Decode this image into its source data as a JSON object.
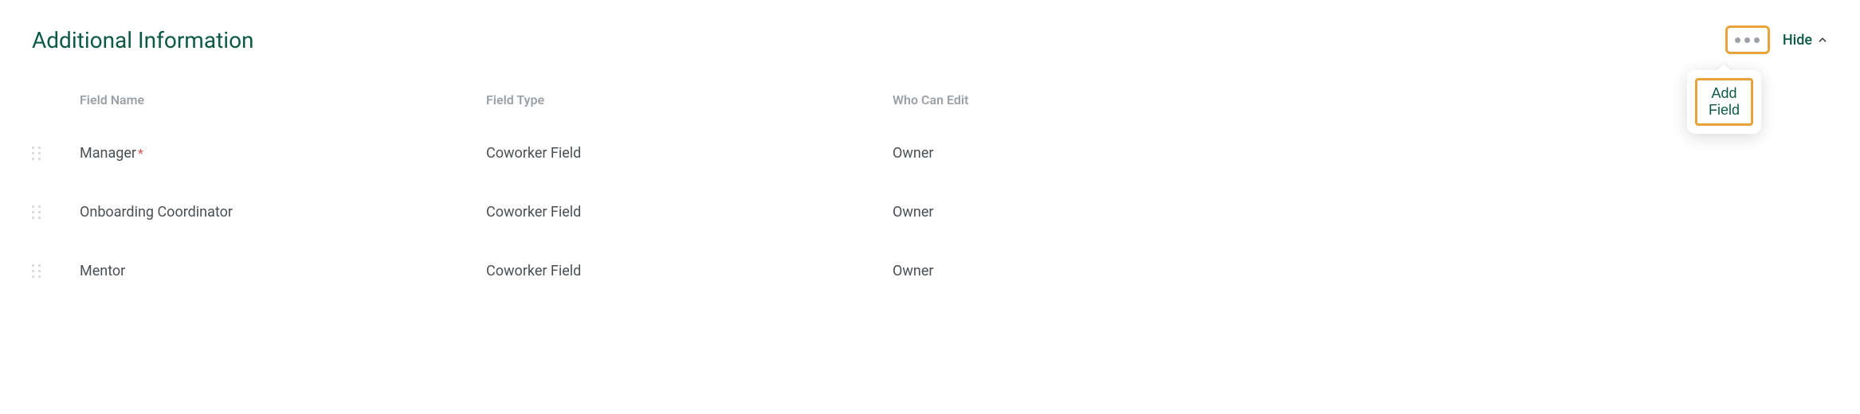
{
  "section": {
    "title": "Additional Information",
    "hide_label": "Hide",
    "add_field_label": "Add Field"
  },
  "columns": {
    "name": "Field Name",
    "type": "Field Type",
    "who": "Who Can Edit"
  },
  "rows": [
    {
      "name": "Manager",
      "required": true,
      "type": "Coworker Field",
      "who": "Owner"
    },
    {
      "name": "Onboarding Coordinator",
      "required": false,
      "type": "Coworker Field",
      "who": "Owner"
    },
    {
      "name": "Mentor",
      "required": false,
      "type": "Coworker Field",
      "who": "Owner"
    }
  ]
}
